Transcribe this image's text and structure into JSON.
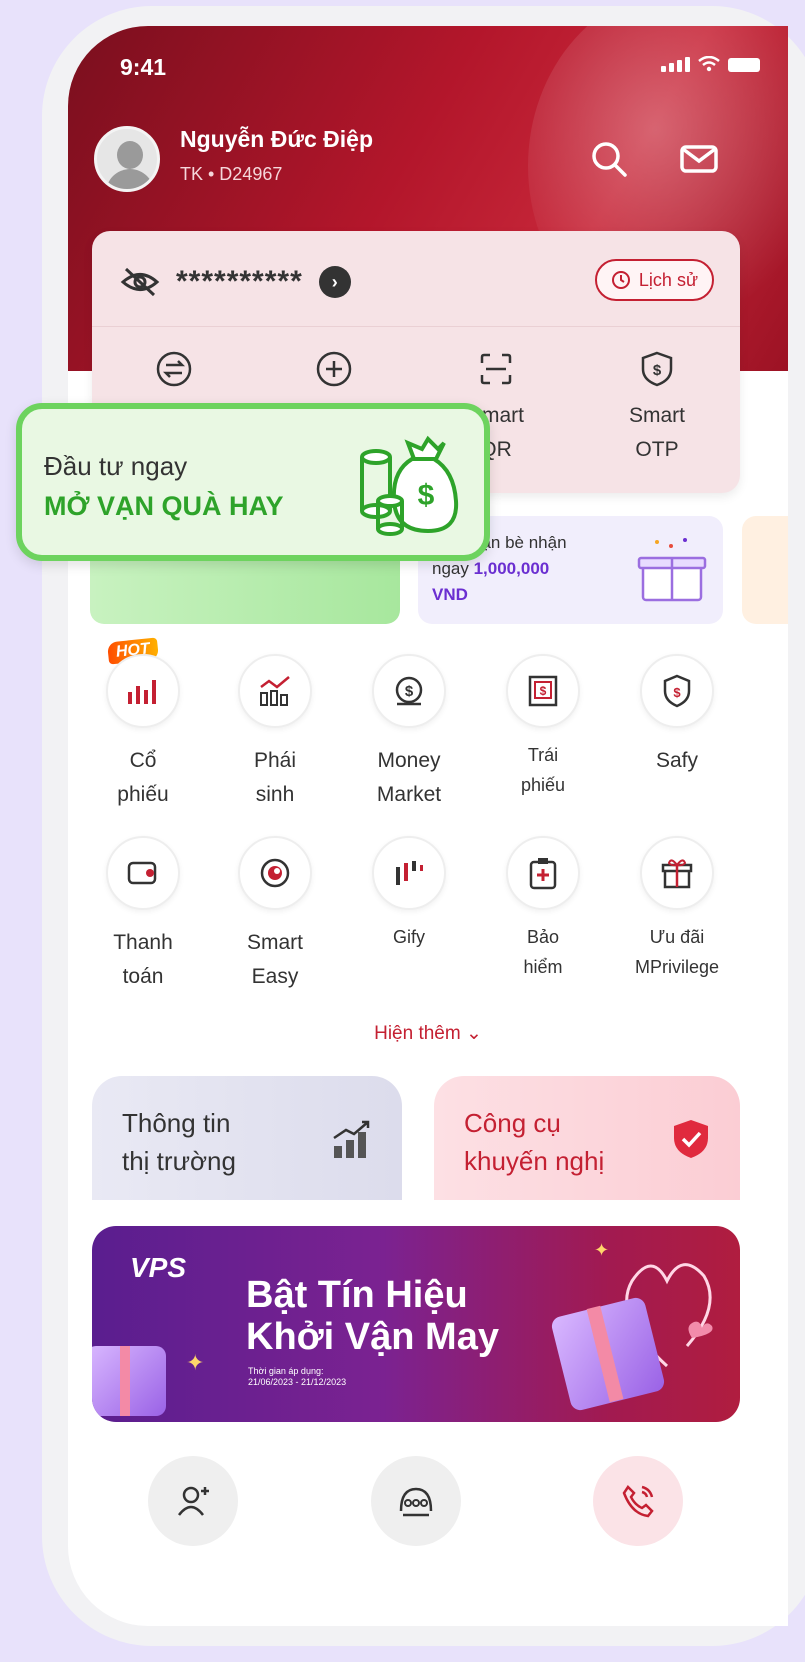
{
  "status": {
    "time": "9:41"
  },
  "user": {
    "name": "Nguyễn Đức Điệp",
    "account": "TK • D24967"
  },
  "balance": {
    "masked": "**********",
    "history_label": "Lịch sử"
  },
  "quick_actions": [
    {
      "label": "",
      "icon": "transfer-icon"
    },
    {
      "label": "",
      "icon": "add-circle-icon"
    },
    {
      "label": "Smart\nQR",
      "icon": "qr-scan-icon"
    },
    {
      "label": "Smart\nOTP",
      "icon": "shield-dollar-icon"
    }
  ],
  "overlay_promo": {
    "line1": "Đầu tư ngay",
    "line2": "MỞ VẠN QUÀ HAY"
  },
  "referral": {
    "text": "bạn bè nhận",
    "text2_prefix": "ngay ",
    "amount": "1,000,000",
    "currency": "VND"
  },
  "hot_badge": "HOT",
  "products_row1": [
    {
      "label": "Cổ\nphiếu",
      "icon": "stock-bars-icon"
    },
    {
      "label": "Phái\nsinh",
      "icon": "derivative-chart-icon"
    },
    {
      "label": "Money\nMarket",
      "icon": "money-bag-icon"
    },
    {
      "label": "Trái\nphiếu",
      "icon": "bond-certificate-icon"
    },
    {
      "label": "Safy",
      "icon": "shield-dollar-icon"
    }
  ],
  "products_row2": [
    {
      "label": "Thanh\ntoán",
      "icon": "wallet-icon"
    },
    {
      "label": "Smart\nEasy",
      "icon": "smart-easy-icon"
    },
    {
      "label": "Gify",
      "icon": "candlestick-icon"
    },
    {
      "label": "Bảo\nhiểm",
      "icon": "insurance-icon"
    },
    {
      "label": "Ưu đãi\nMPrivilege",
      "icon": "gift-icon"
    }
  ],
  "show_more": "Hiện thêm",
  "tiles": {
    "market": "Thông tin\nthị trường",
    "tools": "Công cụ\nkhuyến nghị"
  },
  "banner": {
    "logo": "VPS",
    "title_line1": "Bật Tín Hiệu",
    "title_line2": "Khởi Vận May",
    "subtitle_line1": "Thời gian áp dụng:",
    "subtitle_line2": "21/06/2023 - 21/12/2023"
  },
  "colors": {
    "brand": "#c42032",
    "green": "#2ea32a",
    "purple": "#6b2fd1"
  }
}
